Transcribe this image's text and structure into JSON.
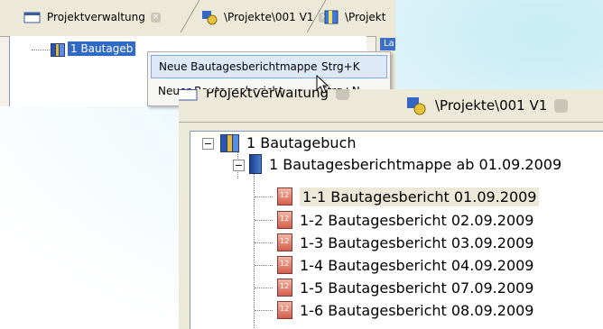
{
  "top_panel": {
    "tabs": [
      {
        "label": "Projektverwaltung"
      },
      {
        "label": "\\Projekte\\001 V1"
      },
      {
        "label": "\\Projekt"
      }
    ],
    "tree": {
      "root_label": "1 Bautageb"
    },
    "side_tab_label": "La"
  },
  "context_menu": {
    "items": [
      {
        "label": "Neue Bautagesberichtmappe",
        "shortcut": "Strg+K",
        "highlighted": true
      },
      {
        "label": "Neuer Bautagesbericht",
        "shortcut": "Strg+N",
        "highlighted": false
      }
    ]
  },
  "zoom_panel": {
    "tabs": [
      {
        "label": "Projektverwaltung"
      },
      {
        "label": "\\Projekte\\001 V1"
      }
    ],
    "tree": {
      "root": {
        "label": "1 Bautagebuch",
        "expanded": true
      },
      "folder": {
        "label": "1 Bautagesberichtmappe ab 01.09.2009",
        "expanded": true
      },
      "reports": [
        {
          "label": "1-1 Bautagesbericht 01.09.2009",
          "selected": true
        },
        {
          "label": "1-2 Bautagesbericht 02.09.2009",
          "selected": false
        },
        {
          "label": "1-3 Bautagesbericht 03.09.2009",
          "selected": false
        },
        {
          "label": "1-4 Bautagesbericht 04.09.2009",
          "selected": false
        },
        {
          "label": "1-5 Bautagesbericht 07.09.2009",
          "selected": false
        },
        {
          "label": "1-6 Bautagesbericht 08.09.2009",
          "selected": false
        }
      ]
    }
  },
  "colors": {
    "selection": "#316ac5",
    "menu_highlight": "#dde9f8",
    "chrome": "#ece9d8",
    "icon_folder": "#2a56b0",
    "icon_report": "#d45e4a"
  }
}
